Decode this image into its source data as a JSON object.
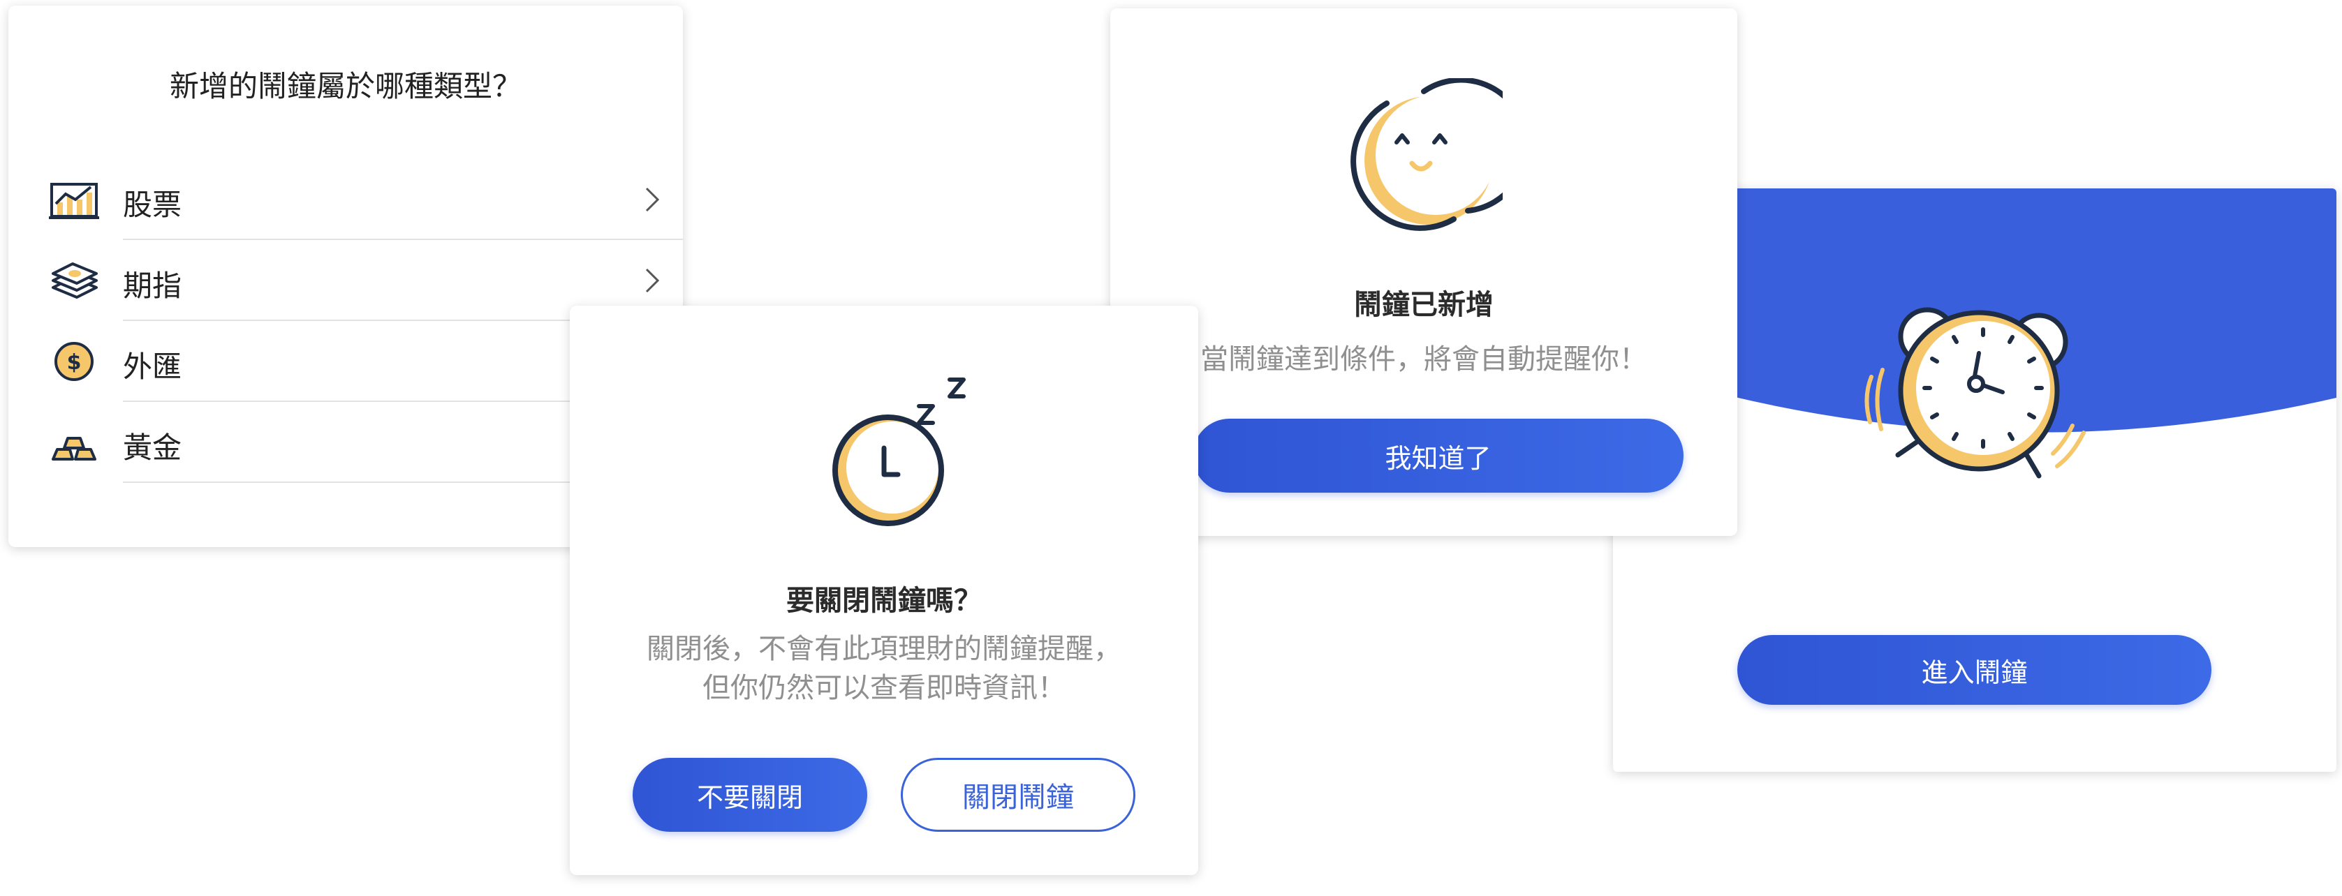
{
  "type_card": {
    "title": "新增的鬧鐘屬於哪種類型？",
    "items": [
      {
        "label": "股票",
        "icon": "stock-chart-icon"
      },
      {
        "label": "期指",
        "icon": "banknote-stack-icon"
      },
      {
        "label": "外匯",
        "icon": "dollar-coin-icon"
      },
      {
        "label": "黃金",
        "icon": "gold-bars-icon"
      }
    ]
  },
  "close_dialog": {
    "icon": "sleeping-clock-icon",
    "heading": "要關閉鬧鐘嗎？",
    "message_line1": "關閉後，不會有此項理財的鬧鐘提醒，",
    "message_line2": "但你仍然可以查看即時資訊！",
    "cancel_label": "不要關閉",
    "confirm_label": "關閉鬧鐘"
  },
  "added_card": {
    "icon": "smiling-face-icon",
    "heading": "鬧鐘已新增",
    "message": "當鬧鐘達到條件，將會自動提醒你！",
    "ok_label": "我知道了"
  },
  "enter_card": {
    "icon": "ringing-alarm-clock-icon",
    "button_label": "進入鬧鐘"
  },
  "colors": {
    "primary": "#3a62d9",
    "accent_yellow": "#f6c66b",
    "navy": "#1e2d44",
    "muted_text": "#8f8f8f"
  }
}
